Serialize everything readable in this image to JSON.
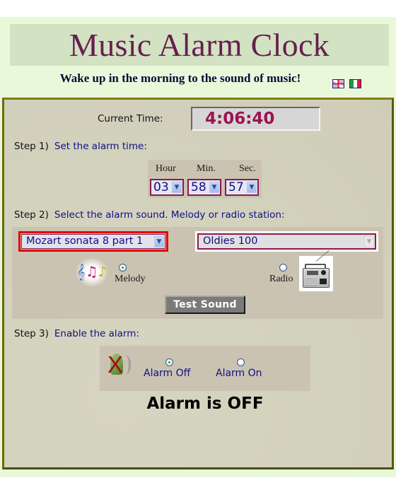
{
  "header": {
    "title": "Music Alarm Clock",
    "subtitle": "Wake up in the morning to the sound of music!",
    "languages": [
      {
        "name": "English",
        "icon": "uk-flag-icon"
      },
      {
        "name": "Italian",
        "icon": "italy-flag-icon"
      }
    ]
  },
  "clock": {
    "label": "Current Time:",
    "value": "4:06:40"
  },
  "step1": {
    "number": "Step 1)",
    "text": "Set the alarm time:",
    "fields": [
      {
        "label": "Hour",
        "value": "03"
      },
      {
        "label": "Min.",
        "value": "58"
      },
      {
        "label": "Sec.",
        "value": "57"
      }
    ]
  },
  "step2": {
    "number": "Step 2)",
    "text": "Select the alarm sound. Melody or radio station:",
    "melody_select": "Mozart sonata 8 part 1",
    "radio_select": "Oldies 100",
    "melody_label": "Melody",
    "radio_label": "Radio",
    "selected_source": "Melody",
    "test_button": "Test Sound"
  },
  "step3": {
    "number": "Step 3)",
    "text": "Enable the alarm:",
    "off_label": "Alarm Off",
    "on_label": "Alarm On",
    "selected": "Alarm Off",
    "status": "Alarm is OFF"
  },
  "colors": {
    "title": "#66204e",
    "time": "#9b1450",
    "link_blue": "#0f0f88",
    "panel_border": "#6b6b08",
    "highlight_red": "#e00000"
  }
}
